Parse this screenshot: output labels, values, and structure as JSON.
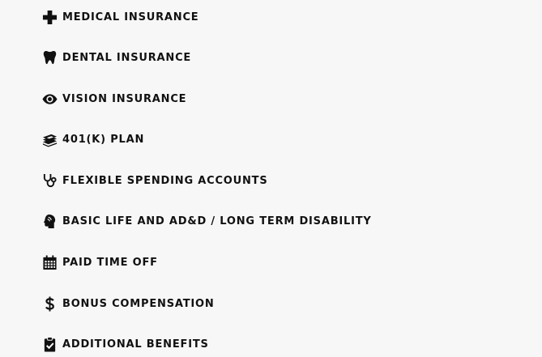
{
  "benefits": [
    {
      "icon": "plus-icon",
      "label": "Medical Insurance"
    },
    {
      "icon": "tooth-icon",
      "label": "Dental Insurance"
    },
    {
      "icon": "eye-icon",
      "label": "Vision Insurance"
    },
    {
      "icon": "money-stack-icon",
      "label": "401(k) Plan"
    },
    {
      "icon": "stethoscope-icon",
      "label": "Flexible Spending Accounts"
    },
    {
      "icon": "head-icon",
      "label": "Basic Life and AD&D / Long Term Disability"
    },
    {
      "icon": "calendar-icon",
      "label": "Paid Time Off"
    },
    {
      "icon": "dollar-icon",
      "label": "Bonus Compensation"
    },
    {
      "icon": "clipboard-check-icon",
      "label": "Additional Benefits"
    }
  ]
}
